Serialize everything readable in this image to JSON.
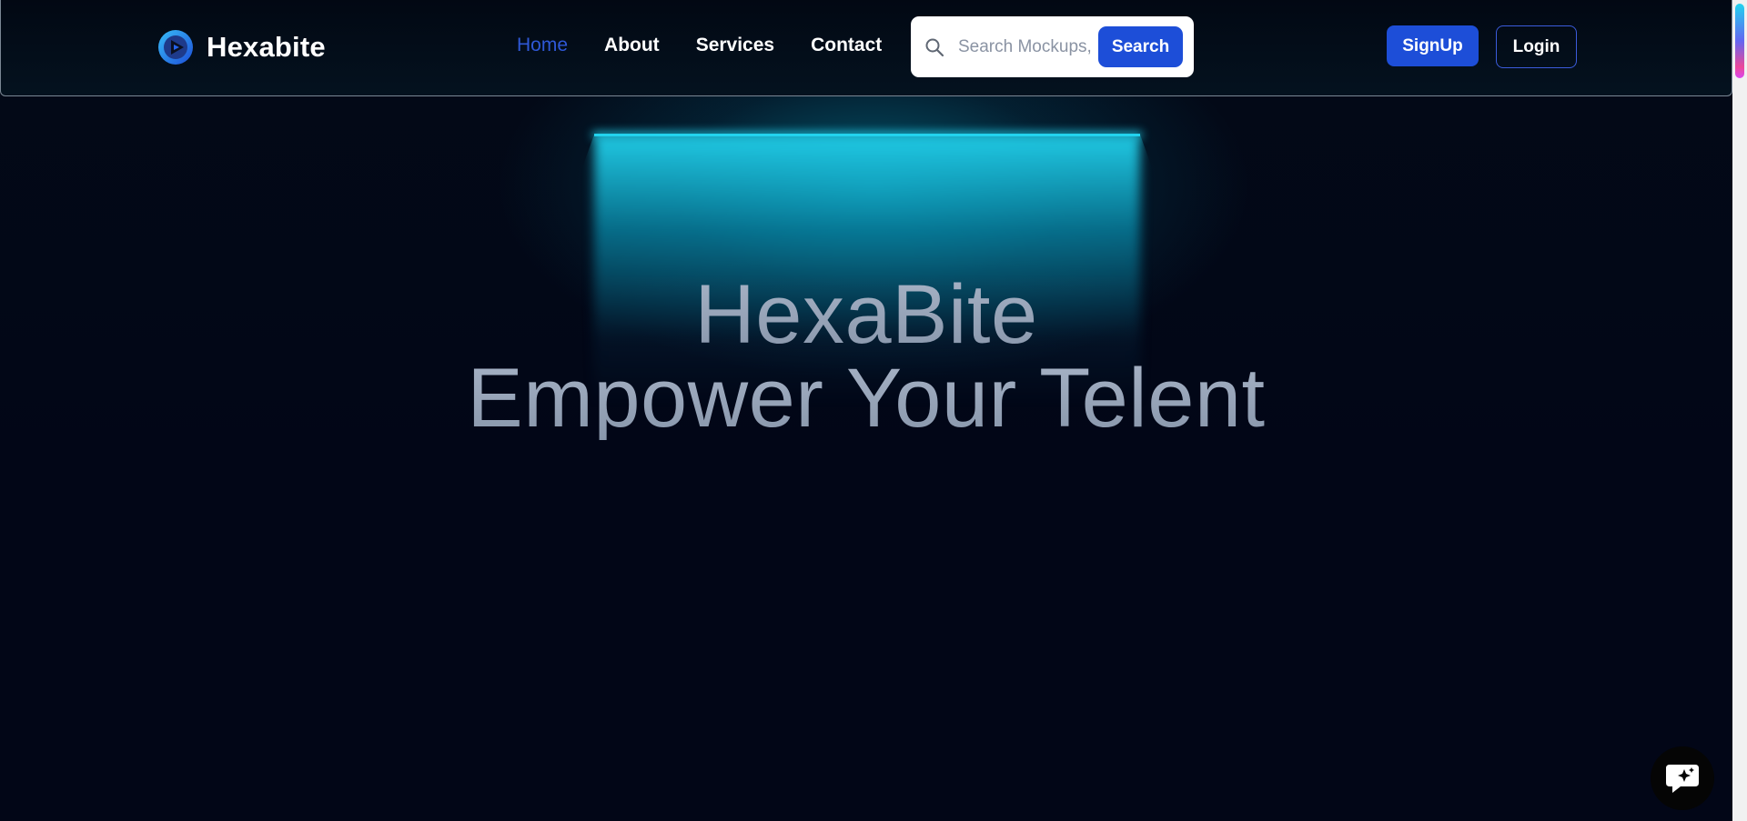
{
  "brand": {
    "name": "Hexabite",
    "logo_icon": "play-circle-logo-icon"
  },
  "nav": {
    "items": [
      {
        "label": "Home",
        "active": true
      },
      {
        "label": "About",
        "active": false
      },
      {
        "label": "Services",
        "active": false
      },
      {
        "label": "Contact",
        "active": false
      }
    ]
  },
  "search": {
    "placeholder": "Search Mockups, Logos...",
    "value": "",
    "button_label": "Search",
    "icon": "search-icon"
  },
  "auth": {
    "signup_label": "SignUp",
    "login_label": "Login"
  },
  "hero": {
    "line1": "HexaBite",
    "line2": "Empower Your Telent"
  },
  "chat": {
    "icon": "chat-sparkle-icon"
  },
  "colors": {
    "accent": "#1d4ed8",
    "active_nav": "#2f58d6",
    "glow": "#22d3ee",
    "background": "#020617"
  }
}
